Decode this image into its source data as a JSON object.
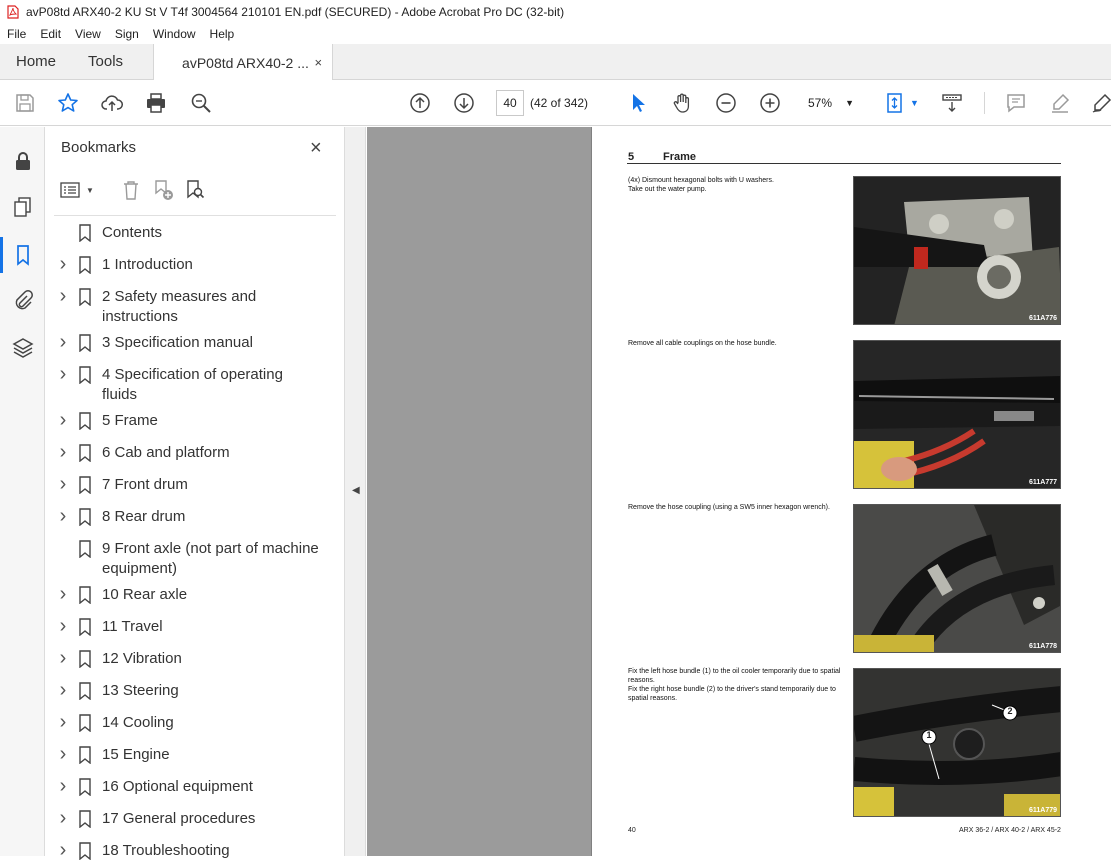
{
  "window": {
    "title": "avP08td ARX40-2 KU St V T4f 3004564 210101 EN.pdf (SECURED) - Adobe Acrobat Pro DC (32-bit)"
  },
  "menu": [
    "File",
    "Edit",
    "View",
    "Sign",
    "Window",
    "Help"
  ],
  "tabs": {
    "home": "Home",
    "tools": "Tools",
    "document": "avP08td ARX40-2 ...",
    "close": "×"
  },
  "toolbar": {
    "page_value": "40",
    "page_count": "(42 of 342)",
    "zoom": "57%"
  },
  "bookmarks": {
    "title": "Bookmarks",
    "close": "×",
    "items": [
      {
        "label": "Contents",
        "expandable": false
      },
      {
        "label": "1 Introduction",
        "expandable": true
      },
      {
        "label": "2 Safety measures and instructions",
        "expandable": true
      },
      {
        "label": "3 Specification manual",
        "expandable": true
      },
      {
        "label": "4 Specification of operating fluids",
        "expandable": true
      },
      {
        "label": "5 Frame",
        "expandable": true
      },
      {
        "label": "6 Cab and platform",
        "expandable": true
      },
      {
        "label": "7 Front drum",
        "expandable": true
      },
      {
        "label": "8 Rear drum",
        "expandable": true
      },
      {
        "label": "9 Front axle (not part of machine equipment)",
        "expandable": false
      },
      {
        "label": "10 Rear axle",
        "expandable": true
      },
      {
        "label": "11 Travel",
        "expandable": true
      },
      {
        "label": "12 Vibration",
        "expandable": true
      },
      {
        "label": "13 Steering",
        "expandable": true
      },
      {
        "label": "14 Cooling",
        "expandable": true
      },
      {
        "label": "15 Engine",
        "expandable": true
      },
      {
        "label": "16 Optional equipment",
        "expandable": true
      },
      {
        "label": "17 General procedures",
        "expandable": true
      },
      {
        "label": "18 Troubleshooting",
        "expandable": true
      }
    ]
  },
  "page": {
    "section_number": "5",
    "section_title": "Frame",
    "steps": [
      {
        "text": "(4x) Dismount hexagonal bolts with U washers.\nTake out the water pump.",
        "caption": "611A776"
      },
      {
        "text": "Remove all cable couplings on the hose bundle.",
        "caption": "611A777"
      },
      {
        "text": "Remove the hose coupling (using a SW5 inner hexagon wrench).",
        "caption": "611A778"
      },
      {
        "text": "Fix the left hose bundle (1) to the oil cooler temporarily due to spatial reasons.\nFix the right hose bundle (2) to the driver's stand temporarily due to spatial reasons.",
        "caption": "611A779"
      }
    ],
    "callouts": [
      "1",
      "2"
    ],
    "footer_left": "40",
    "footer_right": "ARX 36-2 / ARX 40-2 / ARX 45-2"
  }
}
